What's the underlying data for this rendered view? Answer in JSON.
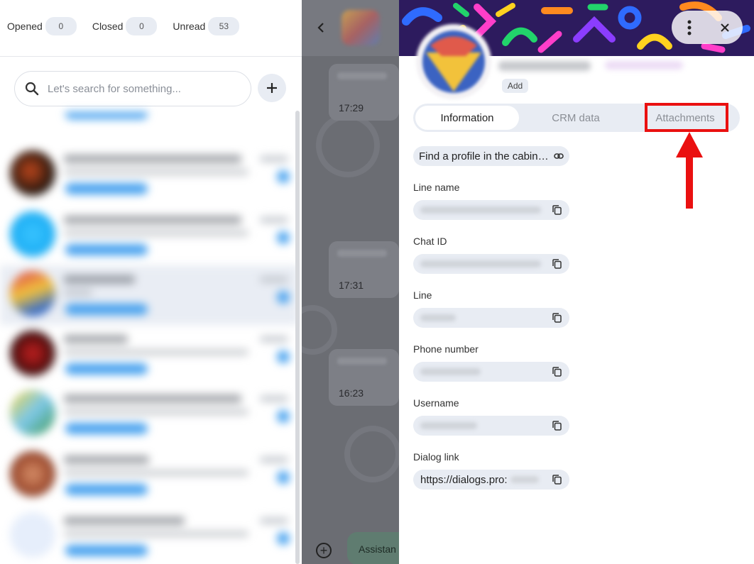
{
  "filters": [
    {
      "label": "Opened",
      "count": "0"
    },
    {
      "label": "Closed",
      "count": "0"
    },
    {
      "label": "Unread",
      "count": "53"
    }
  ],
  "search": {
    "placeholder": "Let's search for something..."
  },
  "chat": {
    "message_times": [
      "17:29",
      "17:31",
      "16:23"
    ],
    "assistant_label": "Assistan"
  },
  "profile": {
    "add_label": "Add",
    "tabs": [
      {
        "label": "Information",
        "active": true
      },
      {
        "label": "CRM data",
        "active": false
      },
      {
        "label": "Attachments",
        "active": false
      }
    ],
    "find_profile_link": "Find a profile in the cabin…",
    "fields": [
      {
        "label": "Line name"
      },
      {
        "label": "Chat ID"
      },
      {
        "label": "Line"
      },
      {
        "label": "Phone number"
      },
      {
        "label": "Username"
      },
      {
        "label": "Dialog link",
        "value": "https://dialogs.pro:"
      }
    ]
  },
  "annotation": {
    "highlight_color": "#ea1010",
    "highlighted_tab": "Attachments"
  },
  "colors": {
    "accent_blue": "#4aa3ef",
    "chip_bg": "#e8ecf3"
  }
}
